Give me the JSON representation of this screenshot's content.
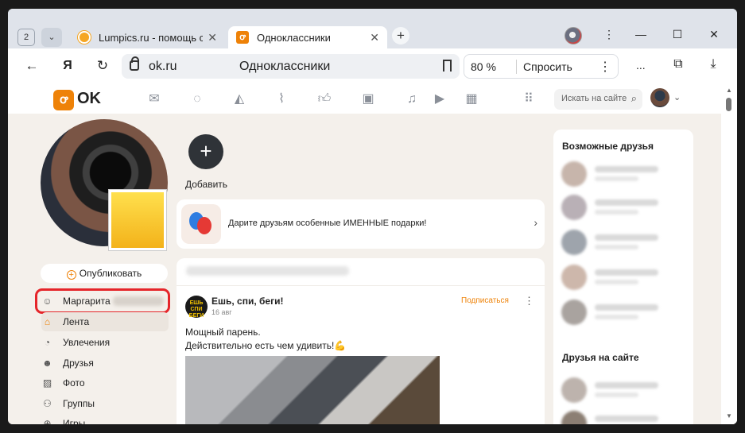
{
  "browser": {
    "tab_count": "2",
    "tabs": [
      {
        "label": "Lumpics.ru - помощь с ком",
        "close": "✕"
      },
      {
        "label": "Одноклассники",
        "close": "✕"
      }
    ],
    "new_tab": "+",
    "window_controls": {
      "minimize": "—",
      "maximize": "☐",
      "close": "✕"
    },
    "menu_dots": "⋮",
    "address": {
      "domain": "ok.ru",
      "title": "Одноклассники"
    },
    "zoom": {
      "value": "80 %",
      "ask_label": "Спросить",
      "more": "⋮"
    },
    "more_label": "..."
  },
  "ok": {
    "logo_text": "OK",
    "search_placeholder": "Искать на сайте",
    "header_icons": [
      "mail-icon",
      "chat-icon",
      "bell-icon",
      "guests-icon",
      "like-icon",
      "video-icon",
      "music-icon",
      "play-icon",
      "calendar-icon",
      "apps-icon"
    ]
  },
  "sidebar": {
    "publish_label": "Опубликовать",
    "items": [
      {
        "label": "Маргарита",
        "icon": "person-icon"
      },
      {
        "label": "Лента",
        "icon": "home-icon"
      },
      {
        "label": "Увлечения",
        "icon": "hobby-icon"
      },
      {
        "label": "Друзья",
        "icon": "friends-icon"
      },
      {
        "label": "Фото",
        "icon": "photo-icon"
      },
      {
        "label": "Группы",
        "icon": "groups-icon"
      },
      {
        "label": "Игры",
        "icon": "games-icon"
      }
    ]
  },
  "center": {
    "add_story_label": "Добавить",
    "gifts_text": "Дарите друзьям особенные ИМЕННЫЕ подарки!",
    "post": {
      "author": "Ешь, спи, беги!",
      "avatar_text": "ЕШЬ СПИ БЕГИ",
      "date": "16 авг",
      "subscribe": "Подписаться",
      "text_line1": "Мощный парень.",
      "text_line2": "Действительно есть чем удивить!💪"
    }
  },
  "right": {
    "possible_friends_title": "Возможные друзья",
    "friends_online_title": "Друзья на сайте"
  },
  "colors": {
    "accent": "#ee8208",
    "highlight": "#e5252a"
  }
}
